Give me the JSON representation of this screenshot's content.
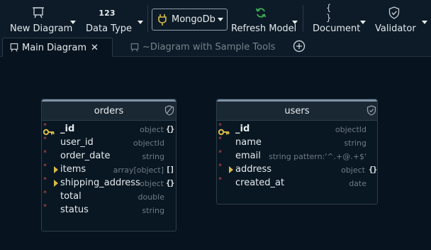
{
  "toolbar": {
    "new_diagram": {
      "label": "New Diagram",
      "icon": "diagram-icon"
    },
    "data_type": {
      "label": "Data Type",
      "icon_text": "123"
    },
    "database": {
      "value": "MongoDb",
      "icon": "plug-icon"
    },
    "refresh_model": {
      "label": "Refresh Model",
      "icon": "refresh-icon"
    },
    "document": {
      "label": "Document",
      "icon_text": "{ }"
    },
    "validator": {
      "label": "Validator",
      "icon": "shield-check-icon"
    }
  },
  "tabs": [
    {
      "label": "Main Diagram",
      "active": true,
      "close": "✕"
    },
    {
      "label": "~Diagram with Sample Tools",
      "active": false
    }
  ],
  "add_tab_icon": "plus-circle-icon",
  "entities": {
    "orders": {
      "name": "orders",
      "fields": [
        {
          "name": "_id",
          "type": "object",
          "brace": "{}",
          "required": true,
          "key": true
        },
        {
          "name": "user_id",
          "type": "objectId",
          "required": true
        },
        {
          "name": "order_date",
          "type": "string",
          "required": true
        },
        {
          "name": "items",
          "type": "array[object]",
          "brace": "[]",
          "required": true,
          "expandable": true
        },
        {
          "name": "shipping_address",
          "type": "object",
          "brace": "{}",
          "required": true,
          "expandable": true
        },
        {
          "name": "total",
          "type": "double",
          "required": true
        },
        {
          "name": "status",
          "type": "string",
          "required": true
        }
      ]
    },
    "users": {
      "name": "users",
      "fields": [
        {
          "name": "_id",
          "type": "objectId",
          "required": true,
          "key": true
        },
        {
          "name": "name",
          "type": "string",
          "required": true
        },
        {
          "name": "email",
          "type": "string pattern:'^.+@.+$'",
          "required": true
        },
        {
          "name": "address",
          "type": "object",
          "brace": "{}",
          "required": true,
          "expandable": true
        },
        {
          "name": "created_at",
          "type": "date",
          "required": true
        }
      ]
    }
  },
  "colors": {
    "background": "#07141f",
    "toolbar": "#0c1b27",
    "refresh_green": "#3fae56",
    "key_gold": "#d7b84a",
    "required_red": "#c74a4a"
  }
}
